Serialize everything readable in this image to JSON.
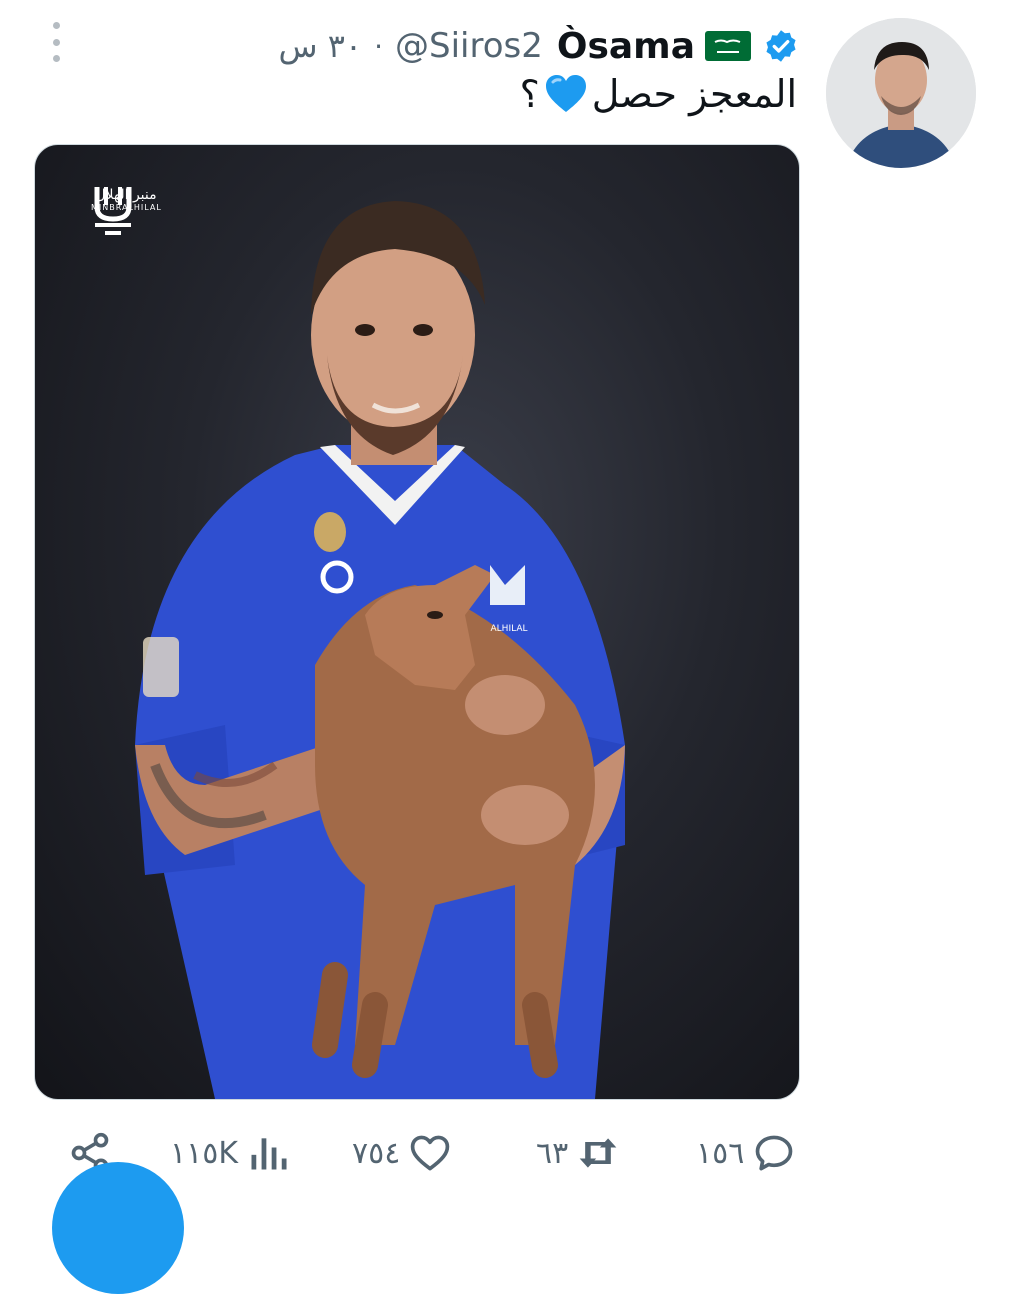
{
  "tweet": {
    "display_name": "Òsama",
    "handle": "@Siiros2",
    "separator": "·",
    "time": "٣٠ س",
    "text": "المعجز حصل",
    "text_suffix": "؟",
    "verified_color": "#1d9bf0"
  },
  "media": {
    "watermark_ar": "منبر الهلال",
    "watermark_en": "MINBRALHILAL",
    "sponsor_text": "ALHILAL"
  },
  "actions": {
    "replies": "١٥٦",
    "retweets": "٦٣",
    "likes": "٧٥٤",
    "views": "١١٥K"
  },
  "icons": {
    "more": "more-vertical-icon",
    "reply": "reply-icon",
    "retweet": "retweet-icon",
    "like": "heart-icon",
    "views": "views-chart-icon",
    "share": "share-icon"
  }
}
